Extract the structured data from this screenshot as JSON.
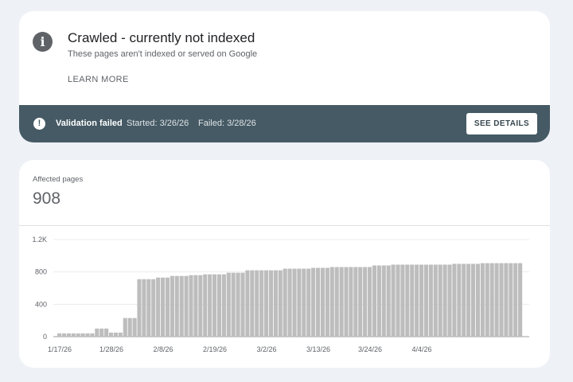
{
  "issue": {
    "title": "Crawled - currently not indexed",
    "subtitle": "These pages aren't indexed or served on Google",
    "learn_more": "LEARN MORE",
    "icon": "info-icon"
  },
  "validation": {
    "status": "Validation failed",
    "started": "Started: 3/26/26",
    "failed": "Failed: 3/28/26",
    "button": "SEE DETAILS",
    "icon": "warning-icon",
    "banner_color": "#455a64"
  },
  "metric": {
    "label": "Affected pages",
    "value": "908"
  },
  "chart_data": {
    "type": "bar",
    "title": "",
    "xlabel": "",
    "ylabel": "",
    "ylim": [
      0,
      1200
    ],
    "yticks": [
      0,
      400,
      800,
      1200
    ],
    "ytick_labels": [
      "0",
      "400",
      "800",
      "1.2K"
    ],
    "xtick_labels": [
      "1/17/26",
      "1/28/26",
      "2/8/26",
      "2/19/26",
      "3/2/26",
      "3/13/26",
      "3/24/26",
      "4/4/26"
    ],
    "x_start": "1/17/26",
    "grid": true,
    "bar_color": "#bdbdbd",
    "values": [
      40,
      40,
      40,
      40,
      40,
      40,
      40,
      40,
      100,
      100,
      100,
      50,
      50,
      50,
      230,
      230,
      230,
      710,
      710,
      710,
      710,
      730,
      730,
      730,
      750,
      750,
      750,
      750,
      760,
      760,
      760,
      770,
      770,
      770,
      770,
      770,
      790,
      790,
      790,
      790,
      820,
      820,
      820,
      820,
      820,
      820,
      820,
      820,
      840,
      840,
      840,
      840,
      840,
      840,
      850,
      850,
      850,
      850,
      860,
      860,
      860,
      860,
      860,
      860,
      860,
      860,
      860,
      880,
      880,
      880,
      880,
      890,
      890,
      890,
      890,
      890,
      890,
      890,
      890,
      890,
      890,
      890,
      890,
      890,
      900,
      900,
      900,
      900,
      900,
      900,
      908,
      908,
      908,
      908,
      908,
      908,
      908,
      908,
      908
    ]
  }
}
